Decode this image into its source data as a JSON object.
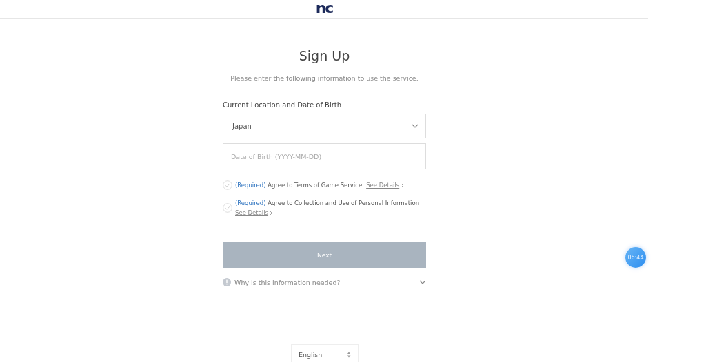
{
  "header": {
    "logo": "nc"
  },
  "title": "Sign Up",
  "subtitle": "Please enter the following information to use the service.",
  "section_label": "Current Location and Date of Birth",
  "location_select": {
    "value": "Japan"
  },
  "birth_date": {
    "placeholder": "Date of Birth (YYYY-MM-DD)"
  },
  "agreements": [
    {
      "required": "(Required)",
      "text": "Agree to Terms of Game Service",
      "link": "See Details",
      "checked": false,
      "wrap": false
    },
    {
      "required": "(Required)",
      "text": "Agree to Collection and Use of Personal Information",
      "link": "See Details",
      "checked": false,
      "wrap": true
    }
  ],
  "next_button": {
    "label": "Next",
    "disabled": true
  },
  "info_toggle": {
    "label": "Why is this information needed?",
    "expanded": false
  },
  "timer": "06:44",
  "language_select": {
    "value": "English"
  }
}
